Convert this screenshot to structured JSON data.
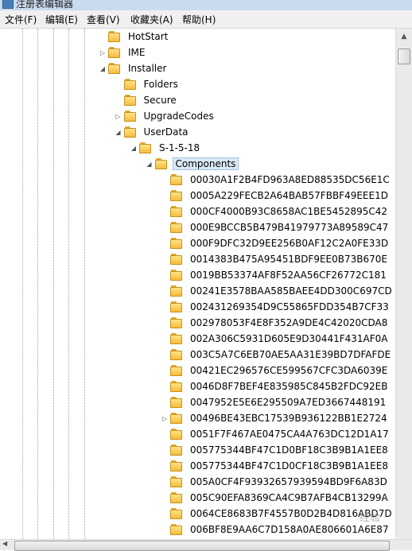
{
  "window": {
    "title": "注册表编辑器"
  },
  "menu": [
    "文件(F)",
    "编辑(E)",
    "查看(V)",
    "收藏夹(A)",
    "帮助(H)"
  ],
  "tree": [
    {
      "label": "HotStart",
      "level": 0,
      "arrow": ""
    },
    {
      "label": "IME",
      "level": 0,
      "arrow": "collapsed"
    },
    {
      "label": "Installer",
      "level": 0,
      "arrow": "expanded"
    },
    {
      "label": "Folders",
      "level": 1,
      "arrow": ""
    },
    {
      "label": "Secure",
      "level": 1,
      "arrow": ""
    },
    {
      "label": "UpgradeCodes",
      "level": 1,
      "arrow": "collapsed"
    },
    {
      "label": "UserData",
      "level": 1,
      "arrow": "expanded"
    },
    {
      "label": "S-1-5-18",
      "level": 2,
      "arrow": "expanded"
    },
    {
      "label": "Components",
      "level": 3,
      "arrow": "expanded",
      "selected": true
    },
    {
      "label": "00030A1F2B4FD963A8ED88535DC56E1C",
      "level": 4,
      "arrow": ""
    },
    {
      "label": "0005A229FECB2A64BAB57FBBF49EEE1D",
      "level": 4,
      "arrow": ""
    },
    {
      "label": "000CF4000B93C8658AC1BE5452895C42",
      "level": 4,
      "arrow": ""
    },
    {
      "label": "000E9BCCB5B479B41979773A89589C47",
      "level": 4,
      "arrow": ""
    },
    {
      "label": "000F9DFC32D9EE256B0AF12C2A0FE33D",
      "level": 4,
      "arrow": ""
    },
    {
      "label": "0014383B475A95451BDF9EE0B73B670E",
      "level": 4,
      "arrow": ""
    },
    {
      "label": "0019BB53374AF8F52AA56CF26772C181",
      "level": 4,
      "arrow": ""
    },
    {
      "label": "00241E3578BAA585BAEE4DD300C697CD",
      "level": 4,
      "arrow": ""
    },
    {
      "label": "002431269354D9C55865FDD354B7CF33",
      "level": 4,
      "arrow": ""
    },
    {
      "label": "002978053F4E8F352A9DE4C42020CDA8",
      "level": 4,
      "arrow": ""
    },
    {
      "label": "002A306C5931D605E9D30441F431AF0A",
      "level": 4,
      "arrow": ""
    },
    {
      "label": "003C5A7C6EB70AE5AA31E39BD7DFAFDE",
      "level": 4,
      "arrow": ""
    },
    {
      "label": "00421EC296576CE599567CFC3DA6039E",
      "level": 4,
      "arrow": ""
    },
    {
      "label": "0046D8F7BEF4E835985C845B2FDC92EB",
      "level": 4,
      "arrow": ""
    },
    {
      "label": "0047952E5E6E295509A7ED3667448191",
      "level": 4,
      "arrow": ""
    },
    {
      "label": "00496BE43EBC17539B936122BB1E2724",
      "level": 4,
      "arrow": "collapsed"
    },
    {
      "label": "0051F7F467AE0475CA4A763DC12D1A17",
      "level": 4,
      "arrow": ""
    },
    {
      "label": "005775344BF47C1D0BF18C3B9B1A1EE8",
      "level": 4,
      "arrow": ""
    },
    {
      "label": "005775344BF47C1D0CF18C3B9B1A1EE8",
      "level": 4,
      "arrow": ""
    },
    {
      "label": "005A0CF4F93932657939594BD9F6A83D",
      "level": 4,
      "arrow": ""
    },
    {
      "label": "005C90EFA8369CA4C9B7AFB4CB13299A",
      "level": 4,
      "arrow": ""
    },
    {
      "label": "0064CE8683B7F4557B0D2B4D816ABD7D",
      "level": 4,
      "arrow": ""
    },
    {
      "label": "006BF8E9AA6C7D158A0AE806601A6E87",
      "level": 4,
      "arrow": ""
    }
  ],
  "watermark": "经验"
}
